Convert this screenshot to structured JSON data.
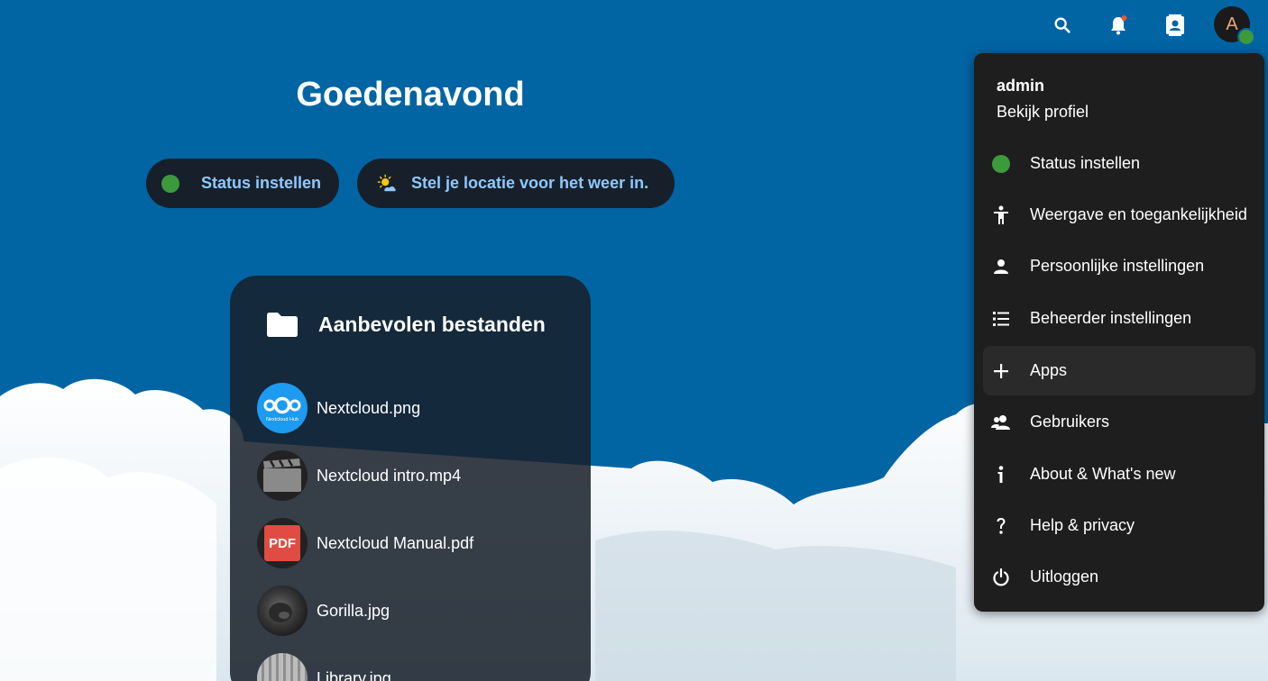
{
  "header": {
    "search_icon": "search-icon",
    "notifications_icon": "bell-icon",
    "contacts_icon": "contacts-icon",
    "avatar_initial": "A"
  },
  "dashboard": {
    "greeting": "Goedenavond",
    "status_button": "Status instellen",
    "weather_button": "Stel je locatie voor het weer in."
  },
  "recommended": {
    "title": "Aanbevolen bestanden",
    "files": [
      {
        "name": "Nextcloud.png",
        "icon": "nextcloud-logo"
      },
      {
        "name": "Nextcloud intro.mp4",
        "icon": "video-icon"
      },
      {
        "name": "Nextcloud Manual.pdf",
        "icon": "pdf-icon"
      },
      {
        "name": "Gorilla.jpg",
        "icon": "image-thumbnail"
      },
      {
        "name": "Library.jpg",
        "icon": "image-thumbnail"
      }
    ],
    "pdf_badge": "PDF",
    "nextcloud_badge": "Nextcloud Hub"
  },
  "user_menu": {
    "username": "admin",
    "profile_link": "Bekijk profiel",
    "items": [
      {
        "label": "Status instellen",
        "icon": "status-dot-icon"
      },
      {
        "label": "Weergave en toegankelijkheid",
        "icon": "accessibility-icon"
      },
      {
        "label": "Persoonlijke instellingen",
        "icon": "person-icon"
      },
      {
        "label": "Beheerder instellingen",
        "icon": "admin-list-icon"
      },
      {
        "label": "Apps",
        "icon": "plus-icon"
      },
      {
        "label": "Gebruikers",
        "icon": "users-icon"
      },
      {
        "label": "About & What's new",
        "icon": "info-icon"
      },
      {
        "label": "Help & privacy",
        "icon": "help-icon"
      },
      {
        "label": "Uitloggen",
        "icon": "power-icon"
      }
    ]
  },
  "colors": {
    "background": "#0165a4",
    "accent_text": "#8ec9ff",
    "status_green": "#3c9a3c",
    "menu_bg": "#1e1e1e"
  }
}
